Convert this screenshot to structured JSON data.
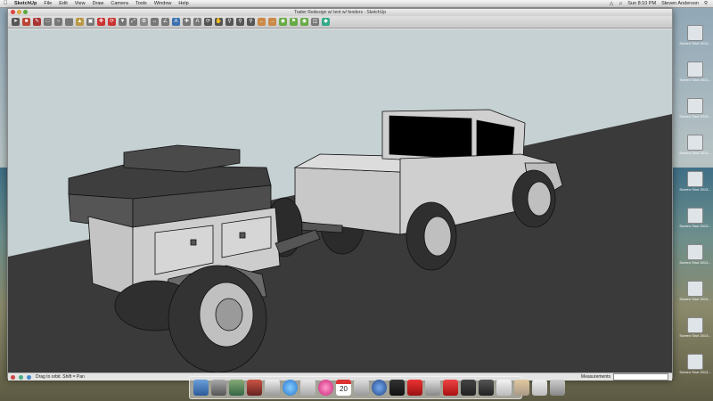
{
  "menubar": {
    "app_name": "SketchUp",
    "menus": [
      "File",
      "Edit",
      "View",
      "Draw",
      "Camera",
      "Tools",
      "Window",
      "Help"
    ],
    "clock": "Sun 8:10 PM",
    "user": "Steven Anderson"
  },
  "window": {
    "title": "Trailer Redesign w/ tent w/ fenders - SketchUp"
  },
  "statusbar": {
    "hint": "Drag to orbit. Shift = Pan",
    "measurements_label": "Measurements"
  },
  "desktop_icons": [
    {
      "label": "Screen Shot 2013...",
      "icon": "file-icon"
    },
    {
      "label": "Screen Shot 2013...",
      "icon": "file-icon"
    },
    {
      "label": "Screen Shot 2013...",
      "icon": "file-icon"
    },
    {
      "label": "Screen Shot 2013...",
      "icon": "file-icon"
    },
    {
      "label": "Screen Shot 2013...",
      "icon": "file-icon"
    },
    {
      "label": "Screen Shot 2013...",
      "icon": "file-icon"
    },
    {
      "label": "Screen Shot 2013...",
      "icon": "file-icon"
    },
    {
      "label": "Screen Shot 2013...",
      "icon": "file-icon"
    },
    {
      "label": "Screen Shot 2013...",
      "icon": "file-icon"
    },
    {
      "label": "Screen Shot 2013...",
      "icon": "file-icon"
    }
  ],
  "dock": {
    "calendar_day": "20"
  },
  "colors": {
    "sky": "#c6d1d3",
    "ground": "#3a3a3a",
    "model_face": "#c8c8c8",
    "model_dark": "#555555"
  }
}
